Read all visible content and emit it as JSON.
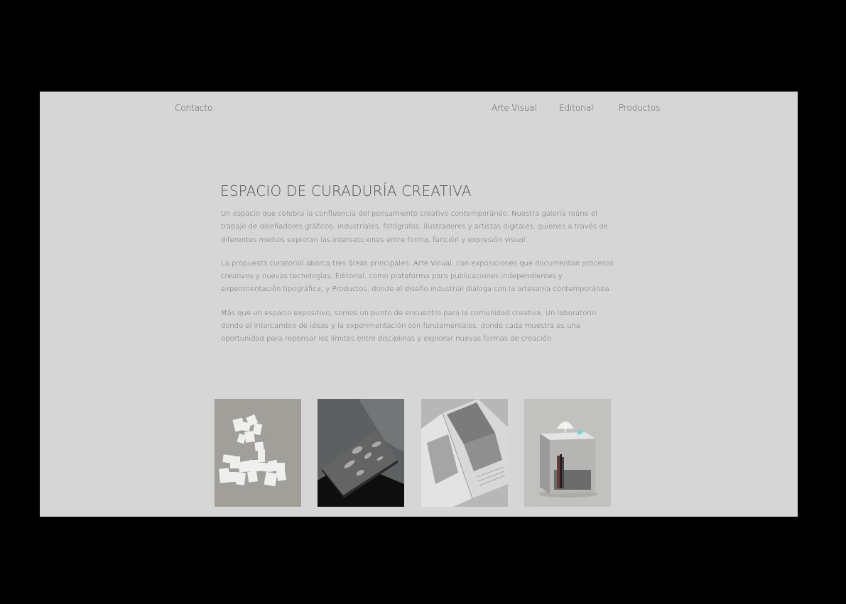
{
  "nav": {
    "contact": "Contacto",
    "items": [
      "Arte Visual",
      "Editorial",
      "Productos"
    ]
  },
  "hero": {
    "title": "ESPACIO DE CURADURÍA CREATIVA",
    "paragraphs": [
      "Un espacio que celebra la confluencia del pensamiento creativo contemporáneo. Nuestra galería reúne el trabajo de diseñadores gráficos, industriales, fotógrafos, ilustradores y artistas digitales, quienes a través de diferentes medios exploran las intersecciones entre forma, función y expresión visual.",
      "La propuesta curatorial abarca tres áreas principales: Arte Visual, con exposiciones que documentan procesos creativos y nuevas tecnologías; Editorial, como plataforma para publicaciones independientes y experimentación tipográfica; y Productos, donde el diseño industrial dialoga con la artesanía contemporánea.",
      "Más que un espacio expositivo, somos un punto de encuentro para la comunidad creativa. Un laboratorio donde el intercambio de ideas y la experimentación son fundamentales, donde cada muestra es una oportunidad para repensar los límites entre disciplinas y explorar nuevas formas de creación."
    ]
  },
  "gallery": [
    {
      "icon": "paper-cutout-artwork"
    },
    {
      "icon": "dark-book-photo"
    },
    {
      "icon": "open-newspaper-spread"
    },
    {
      "icon": "side-table-with-lamp"
    }
  ],
  "colors": {
    "backdrop": "#000000",
    "page": "#d6d6d6",
    "text": "#555555"
  }
}
